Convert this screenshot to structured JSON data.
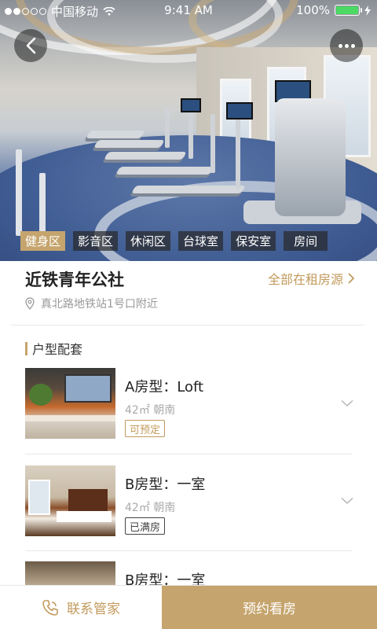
{
  "status_bar": {
    "carrier": "中国移动",
    "time": "9:41 AM",
    "battery_text": "100%",
    "signal_dots_filled": 2,
    "signal_dots_total": 5,
    "battery_color": "#4cd964",
    "wifi_icon": "wifi-icon"
  },
  "hero": {
    "tags": [
      {
        "label": "健身区",
        "active": true
      },
      {
        "label": "影音区",
        "active": false
      },
      {
        "label": "休闲区",
        "active": false
      },
      {
        "label": "台球室",
        "active": false
      },
      {
        "label": "保安室",
        "active": false
      },
      {
        "label": "房间",
        "active": false
      }
    ],
    "back_icon": "back-arrow-icon",
    "more_icon": "more-dots-icon"
  },
  "info": {
    "title": "近铁青年公社",
    "all_rooms_link": "全部在租房源",
    "address": "真北路地铁站1号口附近"
  },
  "section": {
    "title": "户型配套"
  },
  "rooms": [
    {
      "name": "A房型：Loft",
      "meta": "42㎡ 朝南",
      "status": "可预定",
      "status_type": "available"
    },
    {
      "name": "B房型：一室",
      "meta": "42㎡ 朝南",
      "status": "已满房",
      "status_type": "full"
    },
    {
      "name": "B房型：一室"
    }
  ],
  "bottom_bar": {
    "contact_label": "联系管家",
    "book_label": "预约看房"
  },
  "colors": {
    "accent": "#c5a46d",
    "accent_text": "#c29a5c"
  }
}
